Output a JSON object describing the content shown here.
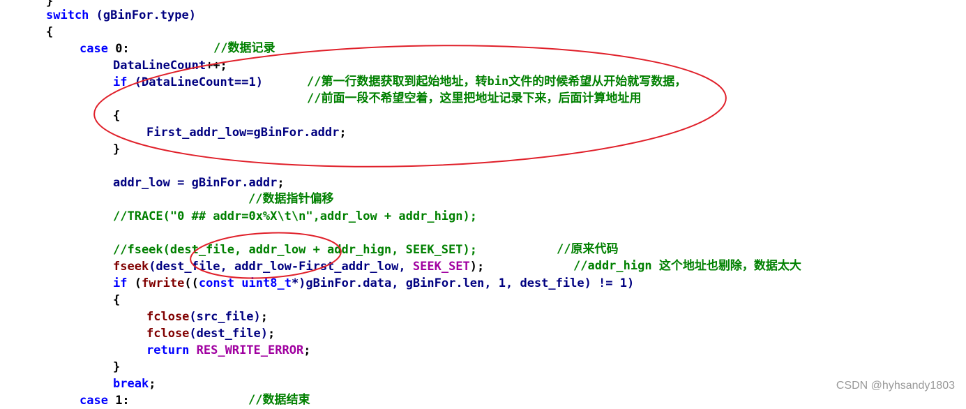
{
  "code": {
    "l0": "}",
    "l1_kw": "switch",
    "l1_rest": " (gBinFor.type)",
    "l2": "{",
    "l3_kw": "case",
    "l3_num": " 0:",
    "l3_cm": "//数据记录",
    "l4_id": "DataLineCount",
    "l4_p": "++;",
    "l5_kw": "if",
    "l5_rest": " (DataLineCount==1)",
    "l5_cm_a": "//第一行数据获取到起始地址，转",
    "l5_cm_b": "bin",
    "l5_cm_c": "文件的时候希望从开始就写数据，",
    "l6_cm": "//前面一段不希望空着，这里把地址记录下来，后面计算地址用",
    "l7": "{",
    "l8_id": "First_addr_low=gBinFor.addr",
    "l8_p": ";",
    "l9": "}",
    "l10_id": "addr_low = gBinFor.addr",
    "l10_p": ";",
    "l11_cm": "//数据指针偏移",
    "l12_cm": "//TRACE(\"0 ## addr=0x%X\\t\\n\",addr_low + addr_hign);",
    "l13_cm": "//fseek(dest_file, addr_low + addr_hign, SEEK_SET);",
    "l13_cm2": "//原来代码",
    "l14_fn": "fseek",
    "l14_id": "(dest_file, addr_low-First_addr_low, ",
    "l14_mac": "SEEK_SET",
    "l14_p": ");",
    "l14_cm_a": "//addr_hign ",
    "l14_cm_b": "这个地址也剔除，数据太大",
    "l15_kw": "if",
    "l15_a": " (",
    "l15_fn": "fwrite",
    "l15_b": "((",
    "l15_kw2": "const uint8_t",
    "l15_c": "*)gBinFor.data, gBinFor.len, 1, dest_file) != 1)",
    "l16": "{",
    "l17_fn": "fclose",
    "l17_id": "(src_file)",
    "l17_p": ";",
    "l18_fn": "fclose",
    "l18_id": "(dest_file)",
    "l18_p": ";",
    "l19_kw": "return",
    "l19_mac": " RES_WRITE_ERROR",
    "l19_p": ";",
    "l20": "}",
    "l21_kw": "break",
    "l21_p": ";",
    "l22_kw": "case",
    "l22_num": " 1:",
    "l22_cm": "//数据结束"
  },
  "annotation_color": "#e0202a",
  "watermark": "CSDN @hyhsandy1803"
}
